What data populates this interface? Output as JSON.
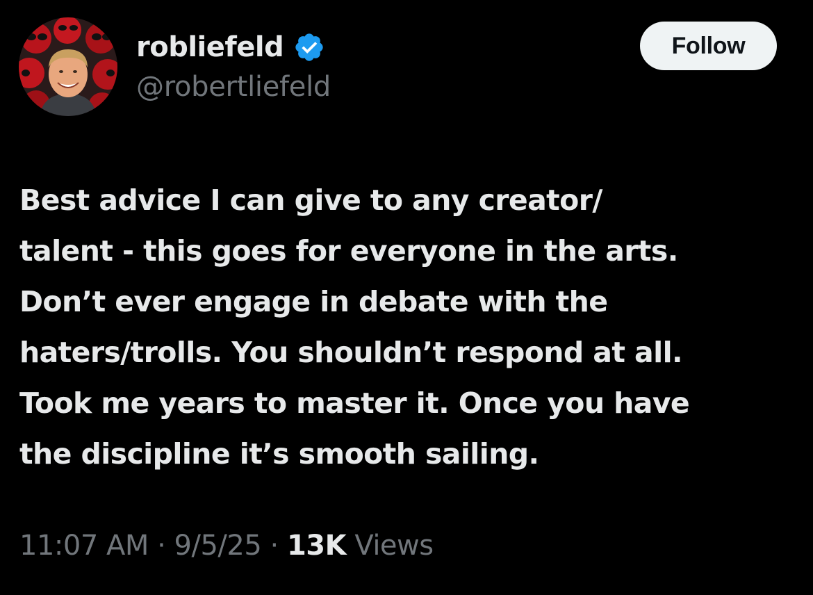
{
  "user": {
    "display_name": "robliefeld",
    "handle": "@robertliefeld",
    "verified": true,
    "avatar_icon": "profile-photo-avatar",
    "verified_icon": "verified-badge-icon"
  },
  "follow_button": {
    "label": "Follow"
  },
  "tweet": {
    "lines": [
      "Best advice I can give to any creator/",
      "talent - this goes for everyone in the arts.",
      "Don’t ever engage in debate with the",
      "haters/trolls. You shouldn’t respond at all.",
      "Took me years to master it. Once you have",
      "the discipline it’s smooth sailing."
    ]
  },
  "meta": {
    "time": "11:07 AM",
    "separator": "·",
    "date": "9/5/25",
    "views_count": "13K",
    "views_label": "Views"
  },
  "colors": {
    "background": "#000000",
    "primary_text": "#e7e9ea",
    "secondary_text": "#71767b",
    "verified_blue": "#1d9bf0",
    "follow_bg": "#eff3f4",
    "follow_text": "#0f1419"
  }
}
